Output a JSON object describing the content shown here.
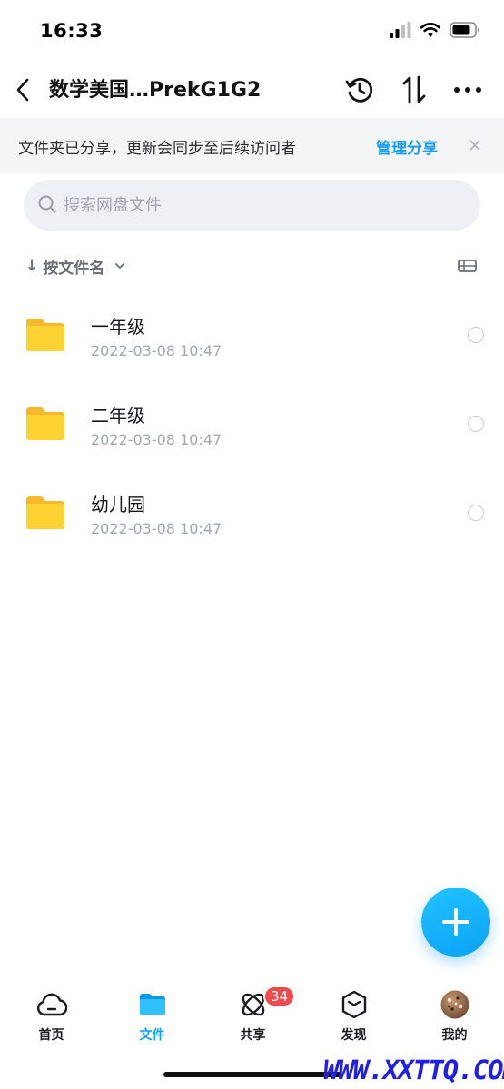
{
  "status_bar": {
    "time": "16:33"
  },
  "nav": {
    "title": "数学美国…PrekG1G2"
  },
  "banner": {
    "text": "文件夹已分享，更新会同步至后续访问者",
    "manage_label": "管理分享",
    "close": "×"
  },
  "search": {
    "placeholder": "搜索网盘文件",
    "value": ""
  },
  "sort": {
    "arrow": "↓",
    "label": "按文件名"
  },
  "files": [
    {
      "name": "一年级",
      "date": "2022-03-08 10:47"
    },
    {
      "name": "二年级",
      "date": "2022-03-08 10:47"
    },
    {
      "name": "幼儿园",
      "date": "2022-03-08 10:47"
    }
  ],
  "tabs": [
    {
      "label": "首页",
      "icon": "cloud-icon"
    },
    {
      "label": "文件",
      "icon": "folder-icon"
    },
    {
      "label": "共享",
      "icon": "share-atom-icon"
    },
    {
      "label": "发现",
      "icon": "cube-icon"
    },
    {
      "label": "我的",
      "icon": "avatar"
    }
  ],
  "share_badge": "34",
  "watermark": "WWW.XXTTQ.COM",
  "colors": {
    "accent": "#0ea3f5",
    "folder": "#ffcc33",
    "badge": "#f04a4a",
    "banner_bg": "#f4f5f7"
  }
}
